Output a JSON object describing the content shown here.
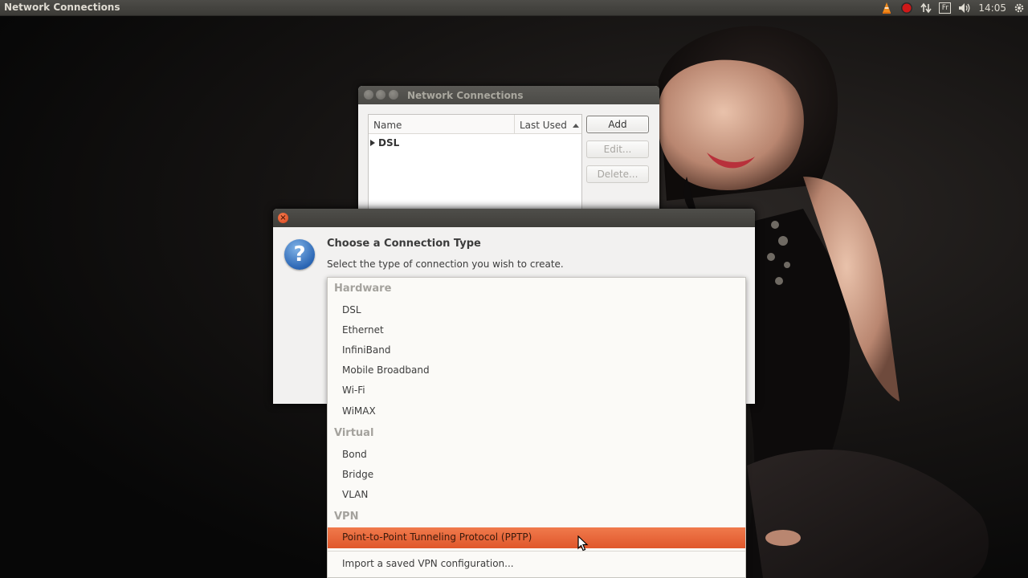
{
  "top_panel": {
    "app_title": "Network Connections",
    "keyboard_layout": "Fr",
    "clock": "14:05"
  },
  "nc_window": {
    "title": "Network Connections",
    "columns": [
      "Name",
      "Last Used"
    ],
    "rows": [
      {
        "label": "DSL"
      }
    ],
    "buttons": {
      "add": "Add",
      "edit": "Edit...",
      "delete": "Delete..."
    }
  },
  "dialog": {
    "heading": "Choose a Connection Type",
    "subtitle": "Select the type of connection you wish to create."
  },
  "menu": {
    "sections": [
      {
        "label": "Hardware",
        "items": [
          "DSL",
          "Ethernet",
          "InfiniBand",
          "Mobile Broadband",
          "Wi-Fi",
          "WiMAX"
        ]
      },
      {
        "label": "Virtual",
        "items": [
          "Bond",
          "Bridge",
          "VLAN"
        ]
      },
      {
        "label": "VPN",
        "items": [
          "Point-to-Point Tunneling Protocol (PPTP)"
        ]
      }
    ],
    "import_item": "Import a saved VPN configuration...",
    "highlighted": "Point-to-Point Tunneling Protocol (PPTP)"
  },
  "colors": {
    "highlight": "#e8623a",
    "panel": "#3c3b37",
    "close_button": "#e0552a"
  }
}
